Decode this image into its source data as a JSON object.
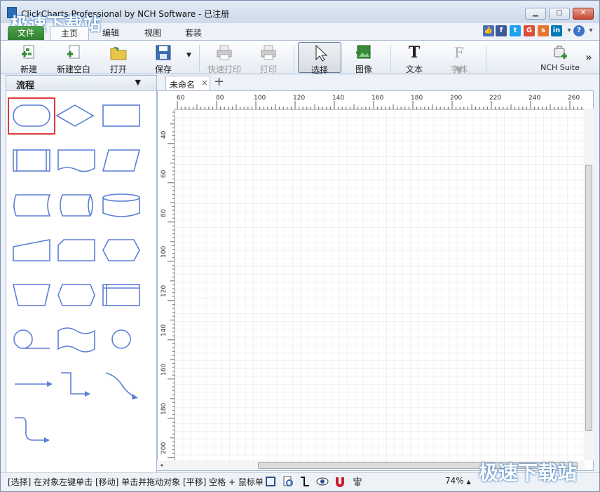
{
  "window": {
    "title": "ClickCharts Professional by NCH Software - 已注册",
    "watermark": "极速下载站"
  },
  "menu_tabs": [
    "文件",
    "主页",
    "编辑",
    "视图",
    "套装"
  ],
  "toolbar": {
    "new": "新建",
    "new_blank": "新建空白",
    "open": "打开",
    "save": "保存",
    "quick_print": "快速打印",
    "print": "打印",
    "select": "选择",
    "image": "图像",
    "text": "文本",
    "font": "字体",
    "suite": "NCH Suite",
    "more": "»"
  },
  "shapes_panel": {
    "category": "流程",
    "shape_names": [
      "terminator",
      "decision",
      "process",
      "predefined-process",
      "document",
      "data",
      "stored-data",
      "direct-access-storage",
      "database",
      "manual-input",
      "display",
      "preparation",
      "manual-operation",
      "loop-limit",
      "internal-storage",
      "sequential-data",
      "punched-tape",
      "connector",
      "straight-connector",
      "elbow-connector",
      "curved-connector",
      "rounded-elbow-connector"
    ]
  },
  "document": {
    "tab_name": "未命名",
    "close_glyph": "×",
    "add_glyph": "+"
  },
  "ruler": {
    "horizontal": [
      "60",
      "80",
      "100",
      "120",
      "140",
      "160",
      "180",
      "200",
      "220",
      "240",
      "260"
    ],
    "vertical": [
      "40",
      "60",
      "80",
      "100",
      "120",
      "140",
      "160",
      "180",
      "200"
    ]
  },
  "statusbar": {
    "hint": "[选择] 在对象左键单击 [移动] 单击并拖动对象 [平移] 空格 + 鼠标单",
    "zoom": "74%"
  },
  "colors": {
    "shape_stroke": "#5b7fd6",
    "selection_red": "#d93a3a",
    "file_tab_green": "#3a8f3a",
    "grid_line": "#e2e6ec"
  }
}
